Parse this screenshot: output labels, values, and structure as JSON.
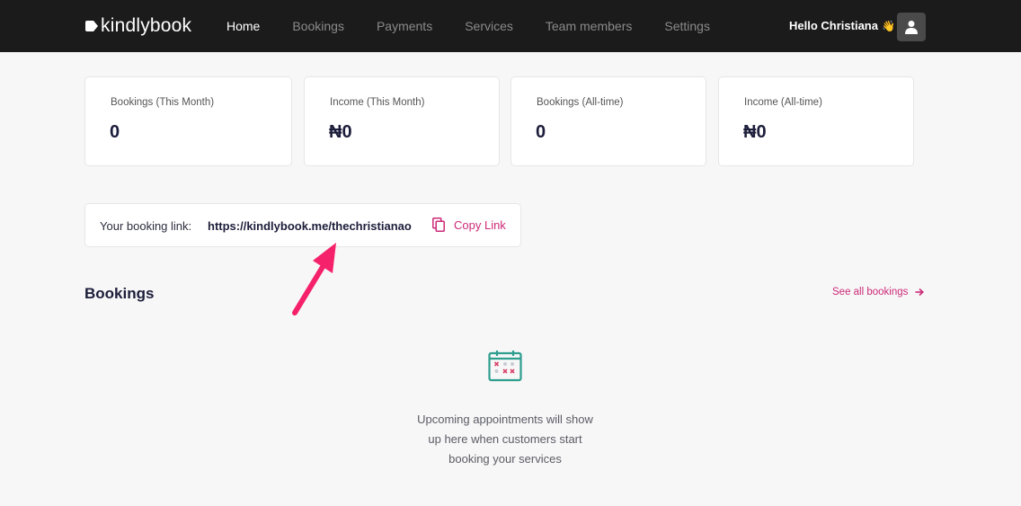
{
  "app": {
    "logo_text": "kindlybook"
  },
  "nav": {
    "items": [
      {
        "label": "Home",
        "active": true
      },
      {
        "label": "Bookings",
        "active": false
      },
      {
        "label": "Payments",
        "active": false
      },
      {
        "label": "Services",
        "active": false
      },
      {
        "label": "Team members",
        "active": false
      },
      {
        "label": "Settings",
        "active": false
      }
    ]
  },
  "user": {
    "greeting": "Hello Christiana",
    "wave_icon": "waving-hand-icon",
    "avatar_icon": "user-icon"
  },
  "stats": [
    {
      "label": "Bookings (This Month)",
      "value": "0"
    },
    {
      "label": "Income (This Month)",
      "value": "₦0"
    },
    {
      "label": "Bookings (All-time)",
      "value": "0"
    },
    {
      "label": "Income (All-time)",
      "value": "₦0"
    }
  ],
  "booking_link": {
    "label": "Your booking link:",
    "url": "https://kindlybook.me/thechristianao",
    "copy_label": "Copy Link",
    "copy_icon": "copy-icon"
  },
  "bookings_section": {
    "title": "Bookings",
    "see_all_label": "See all bookings",
    "empty_icon": "calendar-icon",
    "empty_message_lines": [
      "Upcoming appointments will show",
      "up here when customers start",
      "booking your services"
    ]
  },
  "colors": {
    "accent": "#cc2a78",
    "topbar": "#1b1b1b",
    "background": "#f7f7f7",
    "annotation_arrow": "#f5216a"
  }
}
